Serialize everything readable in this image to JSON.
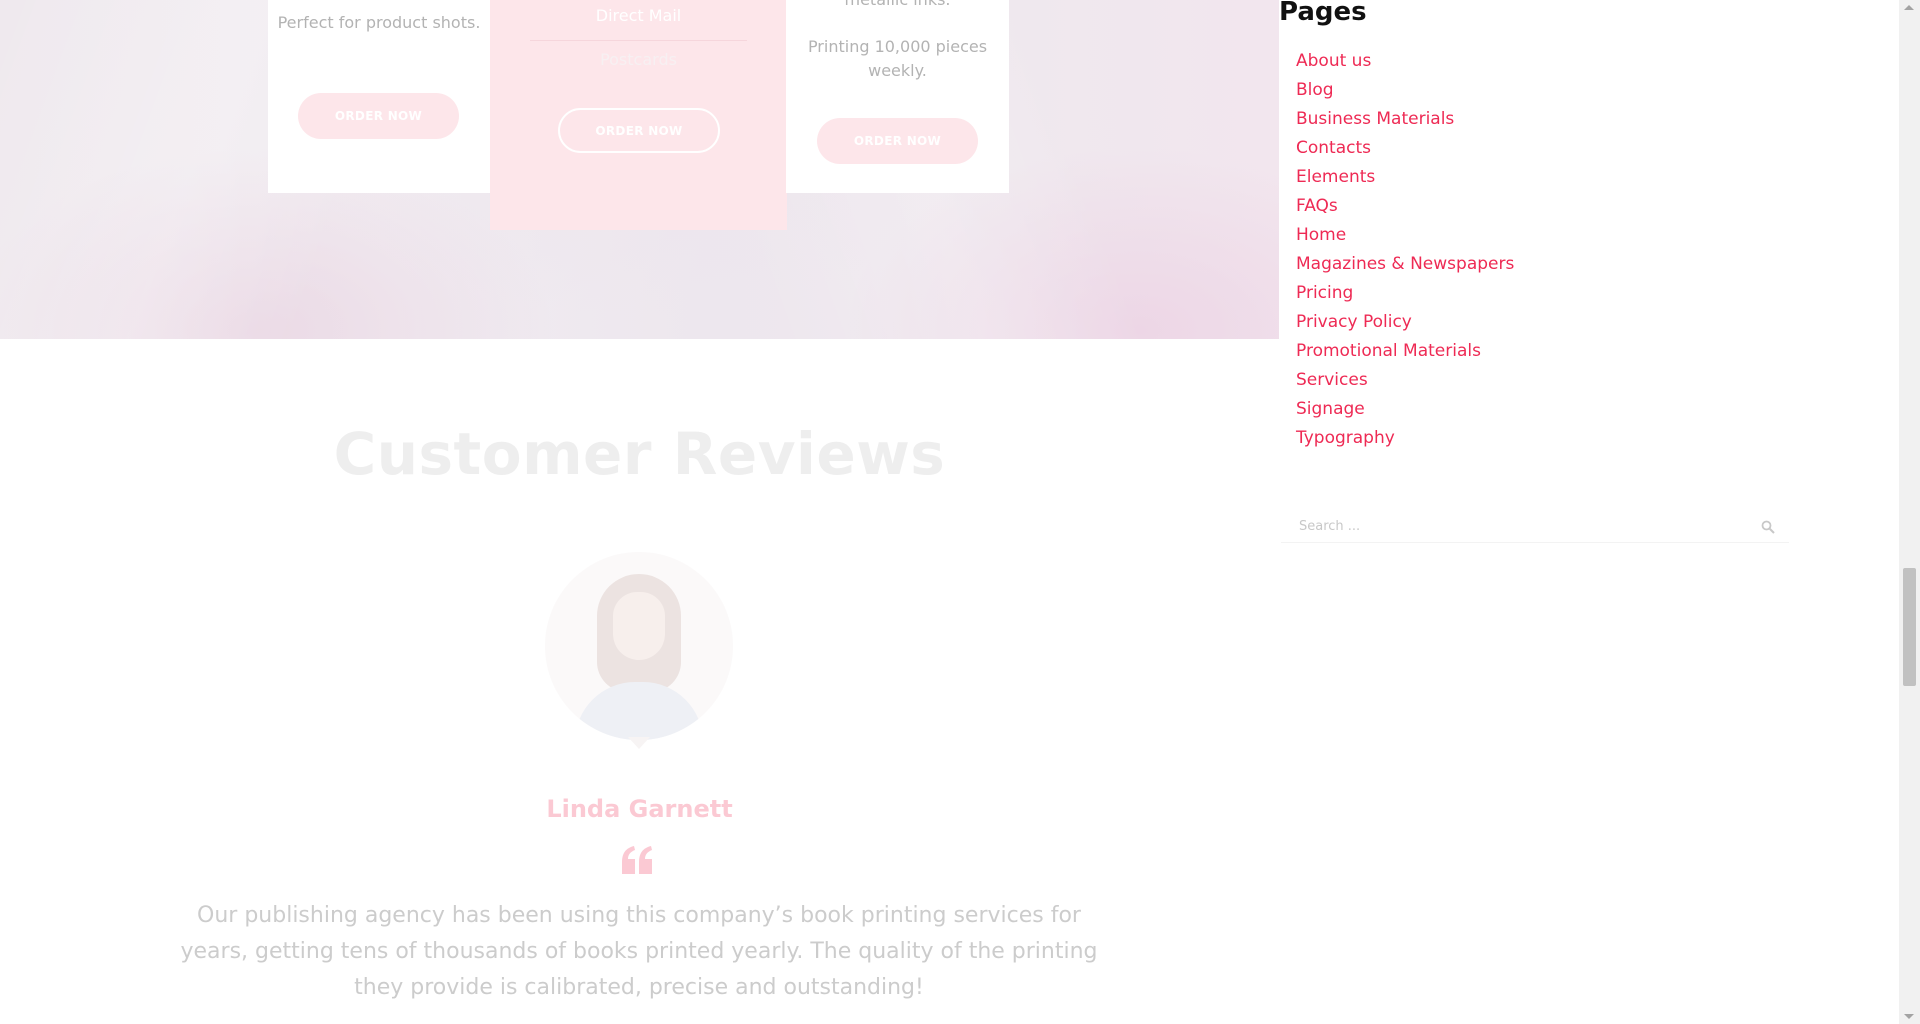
{
  "pricing": {
    "left_card": {
      "description": "Perfect for product shots.",
      "button": "ORDER NOW"
    },
    "featured_card": {
      "items": [
        "Direct Mail",
        "Postcards"
      ],
      "button": "ORDER NOW"
    },
    "right_card": {
      "description_partial": "metallic inks.",
      "description": "Printing 10,000 pieces weekly.",
      "button": "ORDER NOW"
    }
  },
  "reviews": {
    "title": "Customer Reviews",
    "reviewer_name": "Linda Garnett",
    "quote": "Our publishing agency has been using this company’s book printing services for years, getting tens of thousands of books printed yearly. The quality of the printing they provide is calibrated, precise and outstanding!"
  },
  "sidebar": {
    "title": "Pages",
    "pages": [
      "About us",
      "Blog",
      "Business Materials",
      "Contacts",
      "Elements",
      "FAQs",
      "Home",
      "Magazines & Newspapers",
      "Pricing",
      "Privacy Policy",
      "Promotional Materials",
      "Services",
      "Signage",
      "Typography"
    ],
    "search_placeholder": "Search ..."
  },
  "colors": {
    "accent": "#ee2a54",
    "accent_light": "#fde6ea",
    "heading": "#111111"
  },
  "icons": {
    "quote": "quote-icon",
    "search": "search-icon",
    "avatar": "avatar"
  }
}
